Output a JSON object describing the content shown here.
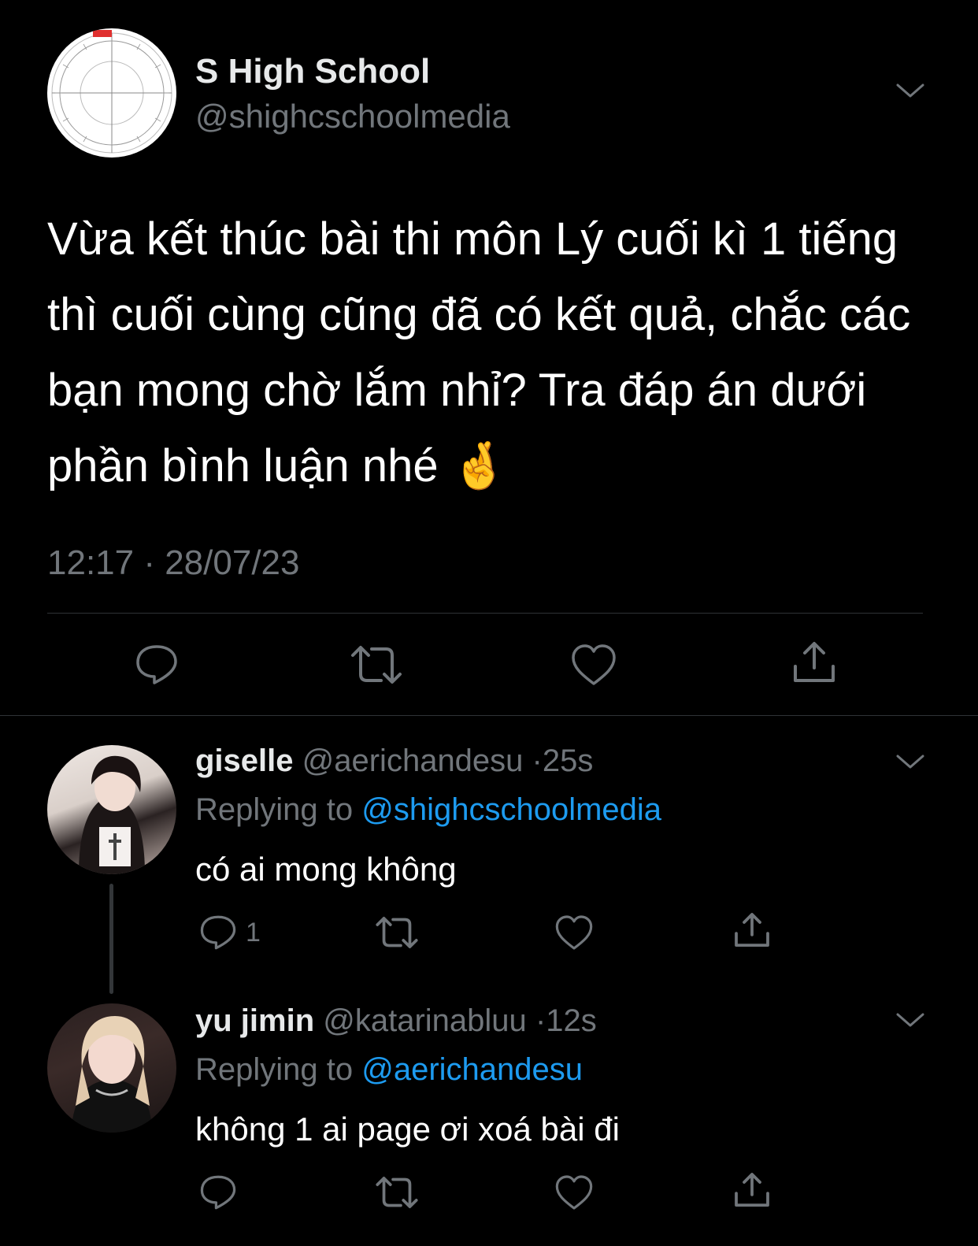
{
  "colors": {
    "background": "#000000",
    "text": "#e7e9ea",
    "secondary": "#71767b",
    "accent": "#1d9bf0"
  },
  "main_tweet": {
    "display_name": "S High School",
    "handle": "@shighcschoolmedia",
    "avatar_icon": "protractor-avatar",
    "text": "Vừa kết thúc bài thi môn Lý cuối kì 1 tiếng thì cuối cùng cũng đã có kết quả, chắc các bạn mong chờ lắm nhỉ? Tra đáp án dưới phần bình luận nhé 🤞",
    "timestamp": "12:17 · 28/07/23",
    "actions": [
      "reply-icon",
      "retweet-icon",
      "like-icon",
      "share-icon"
    ]
  },
  "replies": [
    {
      "display_name": "giselle",
      "handle": "@aerichandesu",
      "separator": "·",
      "time": "25s",
      "replying_prefix": "Replying to",
      "replying_to": "@shighcschoolmedia",
      "text": "có ai mong không",
      "reply_count": "1"
    },
    {
      "display_name": "yu jimin",
      "handle": "@katarinabluu",
      "separator": "·",
      "time": "12s",
      "replying_prefix": "Replying to",
      "replying_to": "@aerichandesu",
      "text": "không 1 ai page ơi xoá bài đi",
      "reply_count": ""
    }
  ]
}
